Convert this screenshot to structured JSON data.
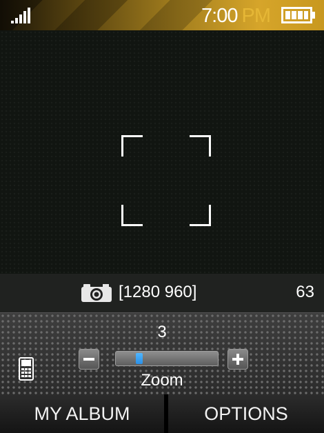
{
  "status_bar": {
    "time": "7:00",
    "ampm": "PM",
    "signal_icon": "signal-bars-icon",
    "battery_icon": "battery-full-icon"
  },
  "viewfinder": {
    "focus_icon": "focus-frame-icon"
  },
  "info_bar": {
    "camera_icon": "camera-icon",
    "resolution": "[1280 960]",
    "shots_remaining": "63"
  },
  "zoom": {
    "value": "3",
    "label": "Zoom",
    "level_fraction": 0.2,
    "minus_icon": "minus-icon",
    "plus_icon": "plus-icon",
    "storage_icon": "phone-memory-icon"
  },
  "softkeys": {
    "left": "MY ALBUM",
    "right": "OPTIONS"
  },
  "colors": {
    "ampm": "#e6b736",
    "zoom_thumb": "#2a8fe6",
    "status_gold": "#d6a52a"
  }
}
